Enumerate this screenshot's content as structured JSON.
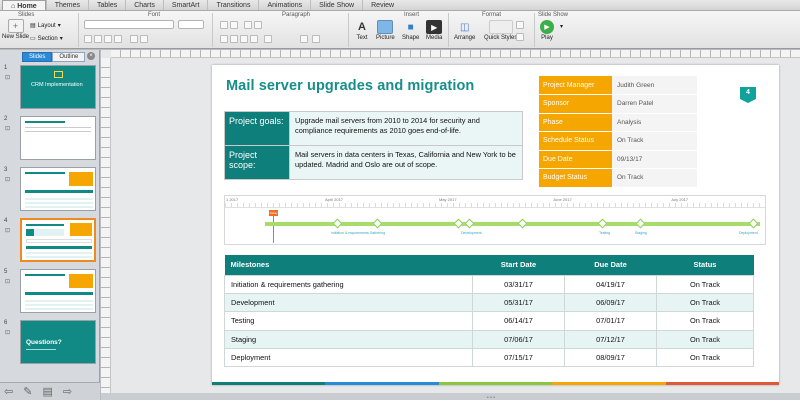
{
  "ribbon_tabs": [
    "Home",
    "Themes",
    "Tables",
    "Charts",
    "SmartArt",
    "Transitions",
    "Animations",
    "Slide Show",
    "Review"
  ],
  "ribbon": {
    "group_slides": "Slides",
    "group_font": "Font",
    "group_paragraph": "Paragraph",
    "group_insert": "Insert",
    "group_format": "Format",
    "group_slideshow": "Slide Show",
    "new_slide": "New Slide",
    "layout": "Layout",
    "section": "Section",
    "insert_buttons": [
      "Text",
      "Picture",
      "Shape",
      "Media"
    ],
    "arrange": "Arrange",
    "quick_styles": "Quick Styles",
    "play": "Play"
  },
  "panel": {
    "tab_slides": "Slides",
    "tab_outline": "Outline",
    "thumbs": [
      {
        "num": "1",
        "title": "CRM Implementation"
      },
      {
        "num": "2",
        "title": ""
      },
      {
        "num": "3",
        "title": ""
      },
      {
        "num": "4",
        "title": ""
      },
      {
        "num": "5",
        "title": ""
      },
      {
        "num": "6",
        "title": "Questions?"
      }
    ]
  },
  "slide": {
    "title": "Mail server upgrades and migration",
    "page_number": "4",
    "goals_label": "Project goals:",
    "goals_text": "Upgrade mail servers from 2010 to 2014 for security and compliance requirements as 2010 goes end-of-life.",
    "scope_label": "Project scope:",
    "scope_text": "Mail servers in data centers in Texas, California and New York to be updated. Madrid and Oslo are out of scope.",
    "info": [
      {
        "key": "Project Manager",
        "value": "Judith Green"
      },
      {
        "key": "Sponsor",
        "value": "Darren Patel"
      },
      {
        "key": "Phase",
        "value": "Analysis"
      },
      {
        "key": "Schedule Status",
        "value": "On Track"
      },
      {
        "key": "Due Date",
        "value": "09/13/17"
      },
      {
        "key": "Budget Status",
        "value": "On Track"
      }
    ],
    "timeline": {
      "months": [
        "1 2017",
        "April 2017",
        "May 2017",
        "June 2017",
        "July 2017"
      ],
      "today_label": "Today",
      "labels": [
        "Initiation & requirements Gathering",
        "Development",
        "Testing",
        "Staging",
        "Deployment"
      ]
    },
    "milestones": {
      "headers": [
        "Milestones",
        "Start Date",
        "Due Date",
        "Status"
      ],
      "rows": [
        [
          "Initiation & requirements gathering",
          "03/31/17",
          "04/19/17",
          "On Track"
        ],
        [
          "Development",
          "05/31/17",
          "06/09/17",
          "On Track"
        ],
        [
          "Testing",
          "06/14/17",
          "07/01/17",
          "On Track"
        ],
        [
          "Staging",
          "07/06/17",
          "07/12/17",
          "On Track"
        ],
        [
          "Deployment",
          "07/15/17",
          "08/09/17",
          "On Track"
        ]
      ]
    },
    "footer_colors": [
      "#0f7f7b",
      "#2a8ad6",
      "#8cc63f",
      "#f5a600",
      "#e05a3a"
    ]
  },
  "colors": {
    "teal": "#0f7f7b",
    "title_teal": "#168f8a",
    "orange": "#f5a600",
    "selected_border": "#f08a1e"
  }
}
